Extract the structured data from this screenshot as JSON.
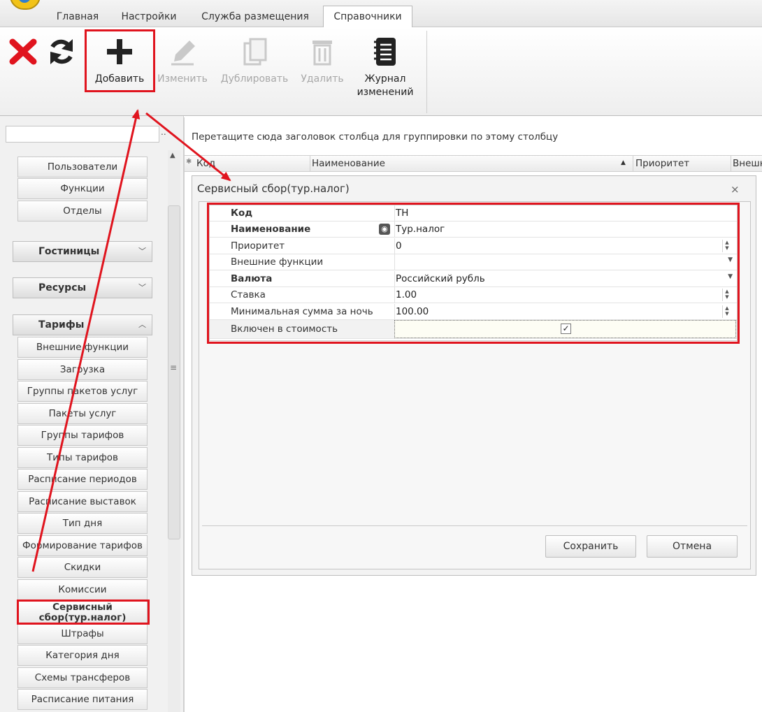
{
  "tabs": [
    "Главная",
    "Настройки",
    "Служба размещения",
    "Справочники"
  ],
  "toolbar": {
    "add": "Добавить",
    "edit": "Изменить",
    "duplicate": "Дублировать",
    "delete": "Удалить",
    "journal_line1": "Журнал",
    "journal_line2": "изменений"
  },
  "left": {
    "search_more": "..",
    "top_items": [
      "Пользователи",
      "Функции",
      "Отделы"
    ],
    "groups": {
      "hotels": "Гостиницы",
      "resources": "Ресурсы",
      "tariffs": "Тарифы"
    },
    "tariff_items": [
      "Внешние функции",
      "Загрузка",
      "Группы пакетов услуг",
      "Пакеты услуг",
      "Группы тарифов",
      "Типы тарифов",
      "Расписание периодов",
      "Расписание выставок",
      "Тип дня",
      "Формирование тарифов",
      "Скидки",
      "Комиссии"
    ],
    "selected_line1": "Сервисный",
    "selected_line2": "сбор(тур.налог)",
    "after_items": [
      "Штрафы",
      "Категория дня",
      "Схемы трансферов",
      "Расписание питания"
    ]
  },
  "grid": {
    "group_hint": "Перетащите сюда заголовок столбца для группировки по этому столбцу",
    "columns": [
      "Код",
      "Наименование",
      "Приоритет",
      "Внешн"
    ]
  },
  "dialog": {
    "title": "Сервисный сбор(тур.налог)",
    "close": "⨯",
    "rows": [
      {
        "label": "Код",
        "value": "TH"
      },
      {
        "label": "Наименование",
        "value": "Тур.налог"
      },
      {
        "label": "Приоритет",
        "value": "0"
      },
      {
        "label": "Внешние функции",
        "value": ""
      },
      {
        "label": "Валюта",
        "value": "Российский рубль"
      },
      {
        "label": "Ставка",
        "value": "1.00"
      },
      {
        "label": "Минимальная сумма за ночь",
        "value": "100.00"
      },
      {
        "label": "Включен в стоимость",
        "value": ""
      }
    ],
    "save": "Сохранить",
    "cancel": "Отмена"
  },
  "colors": {
    "highlight": "#e0141e"
  }
}
